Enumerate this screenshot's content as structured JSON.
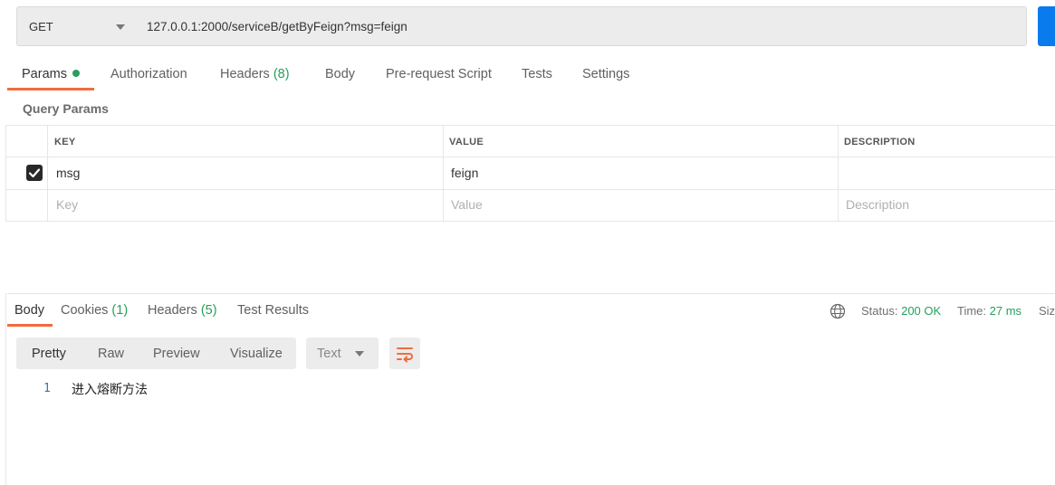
{
  "request": {
    "method": "GET",
    "url": "127.0.0.1:2000/serviceB/getByFeign?msg=feign"
  },
  "request_tabs": {
    "params": "Params",
    "authorization": "Authorization",
    "headers": "Headers",
    "headers_count": "(8)",
    "body": "Body",
    "prerequest": "Pre-request Script",
    "tests": "Tests",
    "settings": "Settings"
  },
  "query_params": {
    "title": "Query Params",
    "columns": {
      "key": "KEY",
      "value": "VALUE",
      "description": "DESCRIPTION"
    },
    "rows": [
      {
        "checked": true,
        "key": "msg",
        "value": "feign",
        "description": ""
      }
    ],
    "placeholder": {
      "key": "Key",
      "value": "Value",
      "description": "Description"
    }
  },
  "response_tabs": {
    "body": "Body",
    "cookies": "Cookies",
    "cookies_count": "(1)",
    "headers": "Headers",
    "headers_count": "(5)",
    "test_results": "Test Results"
  },
  "response_meta": {
    "status_label": "Status:",
    "status_value": "200 OK",
    "time_label": "Time:",
    "time_value": "27 ms",
    "size_label": "Size"
  },
  "view_modes": {
    "pretty": "Pretty",
    "raw": "Raw",
    "preview": "Preview",
    "visualize": "Visualize"
  },
  "format": "Text",
  "response_body": {
    "line_number": "1",
    "line_text": "进入熔断方法"
  },
  "colors": {
    "accent_orange": "#f26b3a",
    "status_green": "#26a05a",
    "send_blue": "#097bed"
  }
}
